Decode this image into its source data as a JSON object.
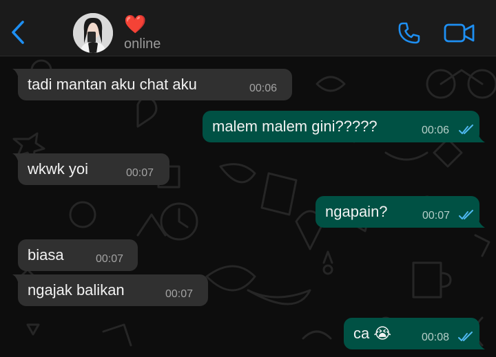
{
  "header": {
    "contact_name": "❤️",
    "status": "online",
    "back_icon": "chevron-left-icon",
    "call_icon": "phone-icon",
    "video_icon": "video-camera-icon",
    "accent_color": "#1e8ff2"
  },
  "messages": [
    {
      "direction": "incoming",
      "text": "tadi mantan aku chat aku",
      "time": "00:06"
    },
    {
      "direction": "outgoing",
      "text": "malem malem gini?????",
      "time": "00:06",
      "read": true
    },
    {
      "direction": "incoming",
      "text": "wkwk yoi",
      "time": "00:07"
    },
    {
      "direction": "outgoing",
      "text": "ngapain?",
      "time": "00:07",
      "read": true
    },
    {
      "direction": "incoming",
      "text": "biasa",
      "time": "00:07"
    },
    {
      "direction": "incoming",
      "text": "ngajak balikan",
      "time": "00:07"
    },
    {
      "direction": "outgoing",
      "text": "ca 😭",
      "time": "00:08",
      "read": true
    }
  ],
  "colors": {
    "incoming_bubble": "#303030",
    "outgoing_bubble": "#005144",
    "read_ticks": "#4fb8f0"
  }
}
